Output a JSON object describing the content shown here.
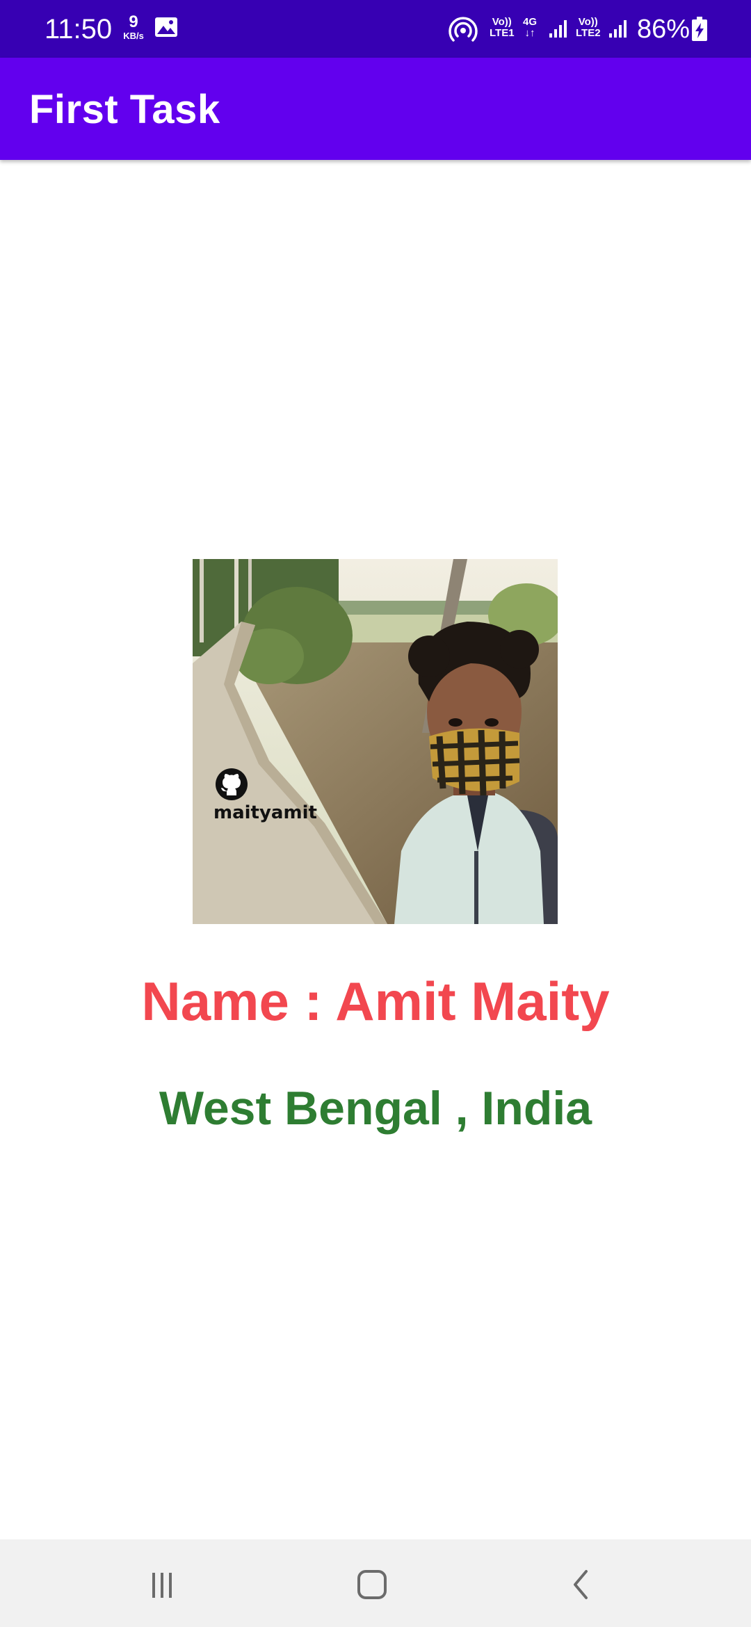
{
  "status_bar": {
    "time": "11:50",
    "net_speed_value": "9",
    "net_speed_unit": "KB/s",
    "sim1_top": "Vo))",
    "sim1_bottom": "LTE1",
    "data_type": "4G",
    "data_arrows": "↓↑",
    "sim2_top": "Vo))",
    "sim2_bottom": "LTE2",
    "battery": "86%",
    "icons": [
      "gallery-icon",
      "hotspot-icon",
      "signal-icon",
      "battery-icon"
    ]
  },
  "app_bar": {
    "title": "First Task",
    "color": "#6200ee",
    "status_color": "#3700b3"
  },
  "profile": {
    "watermark_text": "maityamit",
    "name": "Name : Amit Maity",
    "location": "West Bengal , India",
    "name_color": "#f2474f",
    "location_color": "#2e7d32"
  },
  "nav_bar": {
    "icons": [
      "recent-apps-icon",
      "home-icon",
      "back-icon"
    ]
  }
}
